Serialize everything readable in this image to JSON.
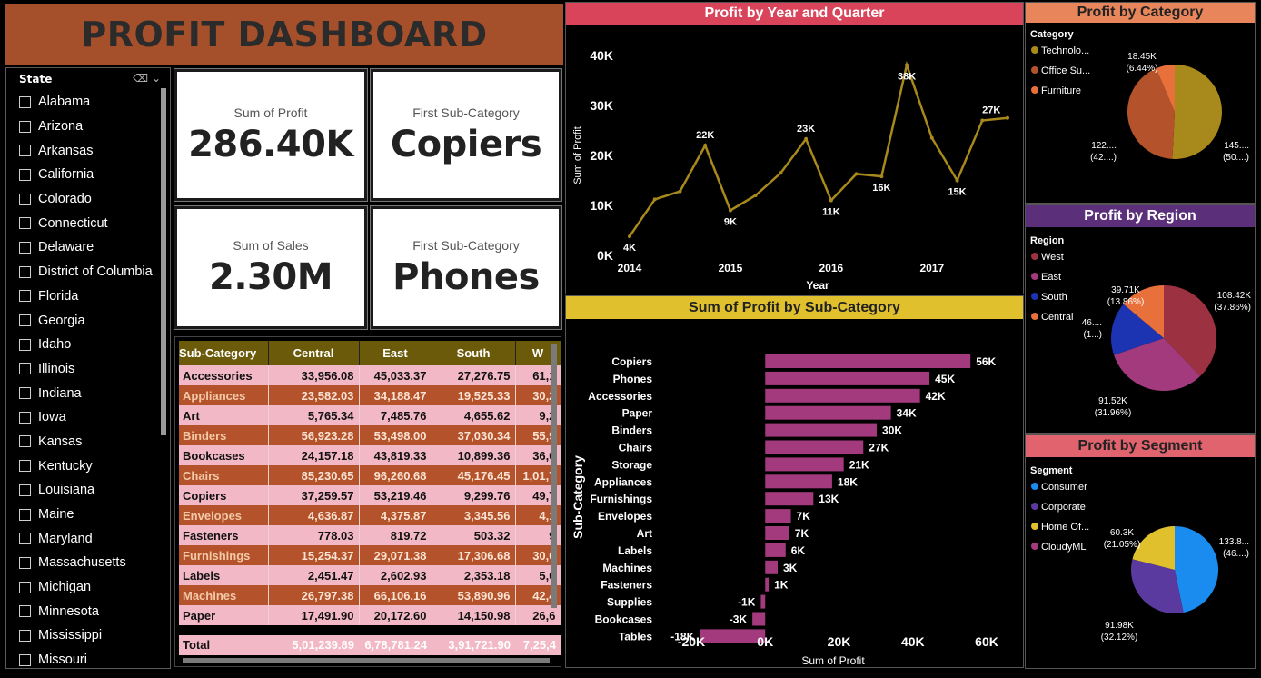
{
  "dashboard": {
    "title": "PROFIT DASHBOARD"
  },
  "slicer": {
    "header": "State",
    "items": [
      "Alabama",
      "Arizona",
      "Arkansas",
      "California",
      "Colorado",
      "Connecticut",
      "Delaware",
      "District of Columbia",
      "Florida",
      "Georgia",
      "Idaho",
      "Illinois",
      "Indiana",
      "Iowa",
      "Kansas",
      "Kentucky",
      "Louisiana",
      "Maine",
      "Maryland",
      "Massachusetts",
      "Michigan",
      "Minnesota",
      "Mississippi",
      "Missouri"
    ]
  },
  "kpis": {
    "profit": {
      "label": "Sum of Profit",
      "value": "286.40K"
    },
    "first_sub_1": {
      "label": "First Sub-Category",
      "value": "Copiers"
    },
    "sales": {
      "label": "Sum of Sales",
      "value": "2.30M"
    },
    "first_sub_2": {
      "label": "First Sub-Category",
      "value": "Phones"
    }
  },
  "matrix": {
    "headers": [
      "Sub-Category",
      "Central",
      "East",
      "South",
      "W"
    ],
    "rows": [
      [
        "Accessories",
        "33,956.08",
        "45,033.37",
        "27,276.75",
        "61,1"
      ],
      [
        "Appliances",
        "23,582.03",
        "34,188.47",
        "19,525.33",
        "30,2"
      ],
      [
        "Art",
        "5,765.34",
        "7,485.76",
        "4,655.62",
        "9,2"
      ],
      [
        "Binders",
        "56,923.28",
        "53,498.00",
        "37,030.34",
        "55,9"
      ],
      [
        "Bookcases",
        "24,157.18",
        "43,819.33",
        "10,899.36",
        "36,0"
      ],
      [
        "Chairs",
        "85,230.65",
        "96,260.68",
        "45,176.45",
        "1,01,7"
      ],
      [
        "Copiers",
        "37,259.57",
        "53,219.46",
        "9,299.76",
        "49,7"
      ],
      [
        "Envelopes",
        "4,636.87",
        "4,375.87",
        "3,345.56",
        "4,1"
      ],
      [
        "Fasteners",
        "778.03",
        "819.72",
        "503.32",
        "9"
      ],
      [
        "Furnishings",
        "15,254.37",
        "29,071.38",
        "17,306.68",
        "30,0"
      ],
      [
        "Labels",
        "2,451.47",
        "2,602.93",
        "2,353.18",
        "5,0"
      ],
      [
        "Machines",
        "26,797.38",
        "66,106.16",
        "53,890.96",
        "42,4"
      ],
      [
        "Paper",
        "17,491.90",
        "20,172.60",
        "14,150.98",
        "26,6"
      ]
    ],
    "total": [
      "Total",
      "5,01,239.89",
      "6,78,781.24",
      "3,91,721.90",
      "7,25,4"
    ]
  },
  "colors": {
    "title_bg": "#a6502b",
    "line": "#a8891b",
    "bar": "#a33a7d",
    "year_title_bg": "#d9445a",
    "sub_title_bg": "#e0c12d",
    "cat_title_bg": "#e8855a",
    "region_title_bg": "#5b2f7a",
    "segment_title_bg": "#e0636e"
  },
  "chart_data": [
    {
      "type": "line",
      "title": "Profit by Year and Quarter",
      "xlabel": "Year",
      "ylabel": "Sum of Profit",
      "year_ticks": [
        "2014",
        "2015",
        "2016",
        "2017"
      ],
      "y_ticks": [
        "0K",
        "10K",
        "20K",
        "30K",
        "40K"
      ],
      "ylim": [
        0,
        40000
      ],
      "values": [
        3800,
        11200,
        12800,
        22000,
        9000,
        12000,
        16500,
        23300,
        11000,
        16300,
        15800,
        38100,
        23500,
        15000,
        27000,
        27500
      ],
      "labels": [
        {
          "i": 0,
          "text": "4K",
          "pos": "below"
        },
        {
          "i": 3,
          "text": "22K",
          "pos": "above"
        },
        {
          "i": 4,
          "text": "9K",
          "pos": "below"
        },
        {
          "i": 7,
          "text": "23K",
          "pos": "above"
        },
        {
          "i": 8,
          "text": "11K",
          "pos": "below"
        },
        {
          "i": 10,
          "text": "16K",
          "pos": "below"
        },
        {
          "i": 11,
          "text": "38K",
          "pos": "below"
        },
        {
          "i": 13,
          "text": "15K",
          "pos": "below"
        },
        {
          "i": 14,
          "text": "27K",
          "pos": "aboveright"
        }
      ],
      "grid": false
    },
    {
      "type": "bar",
      "orientation": "horizontal",
      "title": "Sum of Profit by Sub-Category",
      "xlabel": "Sum of Profit",
      "ylabel": "Sub-Category",
      "categories": [
        "Copiers",
        "Phones",
        "Accessories",
        "Paper",
        "Binders",
        "Chairs",
        "Storage",
        "Appliances",
        "Furnishings",
        "Envelopes",
        "Art",
        "Labels",
        "Machines",
        "Fasteners",
        "Supplies",
        "Bookcases",
        "Tables"
      ],
      "values": [
        55618,
        44516,
        41937,
        34054,
        30222,
        26590,
        21279,
        18138,
        13059,
        6964,
        6528,
        5546,
        3385,
        950,
        -1189,
        -3473,
        -17725
      ],
      "data_labels": [
        "56K",
        "45K",
        "42K",
        "34K",
        "30K",
        "27K",
        "21K",
        "18K",
        "13K",
        "7K",
        "7K",
        "6K",
        "3K",
        "1K",
        "-1K",
        "-3K",
        "-18K"
      ],
      "x_ticks": [
        "-20K",
        "0K",
        "20K",
        "40K",
        "60K"
      ],
      "xlim": [
        -20000,
        60000
      ]
    },
    {
      "type": "pie",
      "title": "Profit by Category",
      "legend_title": "Category",
      "legend": [
        "Technolo...",
        "Office Su...",
        "Furniture"
      ],
      "values": [
        145455,
        122491,
        18451
      ],
      "slice_colors": [
        "#a8891b",
        "#b4532b",
        "#e8703a"
      ],
      "slice_labels": [
        {
          "l1": "145....",
          "l2": "(50....)"
        },
        {
          "l1": "122....",
          "l2": "(42....)"
        },
        {
          "l1": "18.45K",
          "l2": "(6.44%)"
        }
      ]
    },
    {
      "type": "pie",
      "title": "Profit by Region",
      "legend_title": "Region",
      "legend": [
        "West",
        "East",
        "South",
        "Central"
      ],
      "values": [
        108420,
        91520,
        46750,
        39710
      ],
      "slice_colors": [
        "#9c3241",
        "#a33a7d",
        "#1d34b2",
        "#e8703a"
      ],
      "slice_labels": [
        {
          "l1": "108.42K",
          "l2": "(37.86%)"
        },
        {
          "l1": "91.52K",
          "l2": "(31.96%)"
        },
        {
          "l1": "46....",
          "l2": "(1...)"
        },
        {
          "l1": "39.71K",
          "l2": "(13.86%)"
        }
      ]
    },
    {
      "type": "pie",
      "title": "Profit by Segment",
      "legend_title": "Segment",
      "legend": [
        "Consumer",
        "Corporate",
        "Home Of...",
        "CloudyML"
      ],
      "values": [
        133800,
        91980,
        60300
      ],
      "slice_colors": [
        "#1a8cf0",
        "#5b3aa0",
        "#e0c12d",
        "#a33a7d"
      ],
      "slice_labels": [
        {
          "l1": "133.8...",
          "l2": "(46....)"
        },
        {
          "l1": "91.98K",
          "l2": "(32.12%)"
        },
        {
          "l1": "60.3K",
          "l2": "(21.05%)"
        }
      ]
    }
  ]
}
